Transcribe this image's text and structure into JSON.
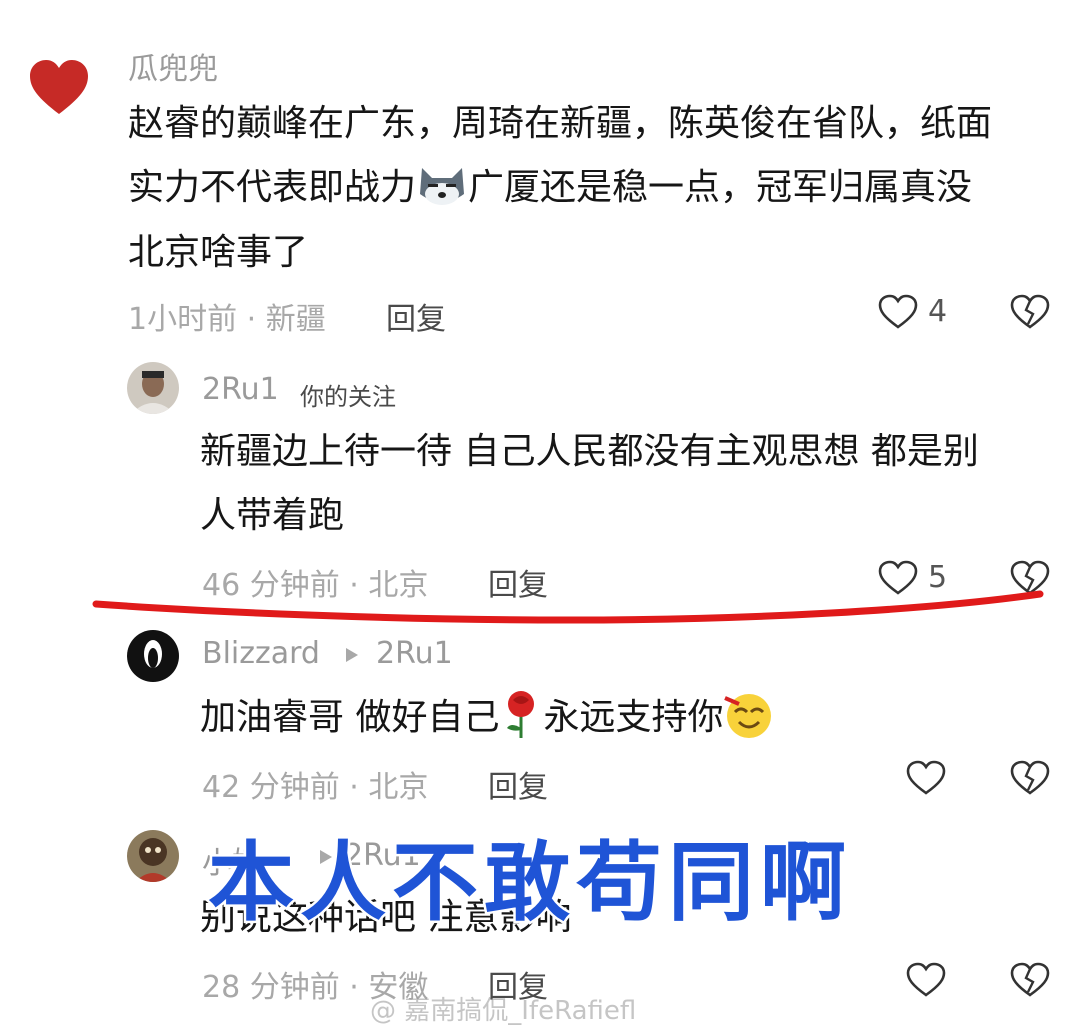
{
  "comments": [
    {
      "username": "瓜兜兜",
      "text_line1": "赵睿的巅峰在广东，周琦在新疆，陈英俊在省队，纸面",
      "text_line2a": "实力不代表即战力",
      "text_line2b": "广厦还是稳一点，冠军归属真没",
      "text_line3": "北京啥事了",
      "meta": "1小时前 · 新疆",
      "reply_label": "回复",
      "like_count": "4"
    },
    {
      "username": "2Ru1",
      "tag": "你的关注",
      "text_line1": "新疆边上待一待 自己人民都没有主观思想 都是别",
      "text_line2": "人带着跑",
      "meta": "46 分钟前 · 北京",
      "reply_label": "回复",
      "like_count": "5"
    },
    {
      "username": "Blizzard",
      "reply_to": "2Ru1",
      "text_a": "加油睿哥 做好自己",
      "text_b": "永远支持你",
      "meta": "42 分钟前 · 北京",
      "reply_label": "回复",
      "like_count": ""
    },
    {
      "username": "小奶",
      "reply_to": "2Ru1",
      "text": "别说这种话吧 注意影响",
      "meta": "28 分钟前 · 安徽",
      "reply_label": "回复"
    }
  ],
  "overlay_caption": "本人不敢苟同啊",
  "watermark": "@ 嘉南搞侃_IfeRafiefl",
  "colors": {
    "underline": "#e01a1a",
    "caption": "#1f54d6",
    "heart": "#c62a26"
  }
}
